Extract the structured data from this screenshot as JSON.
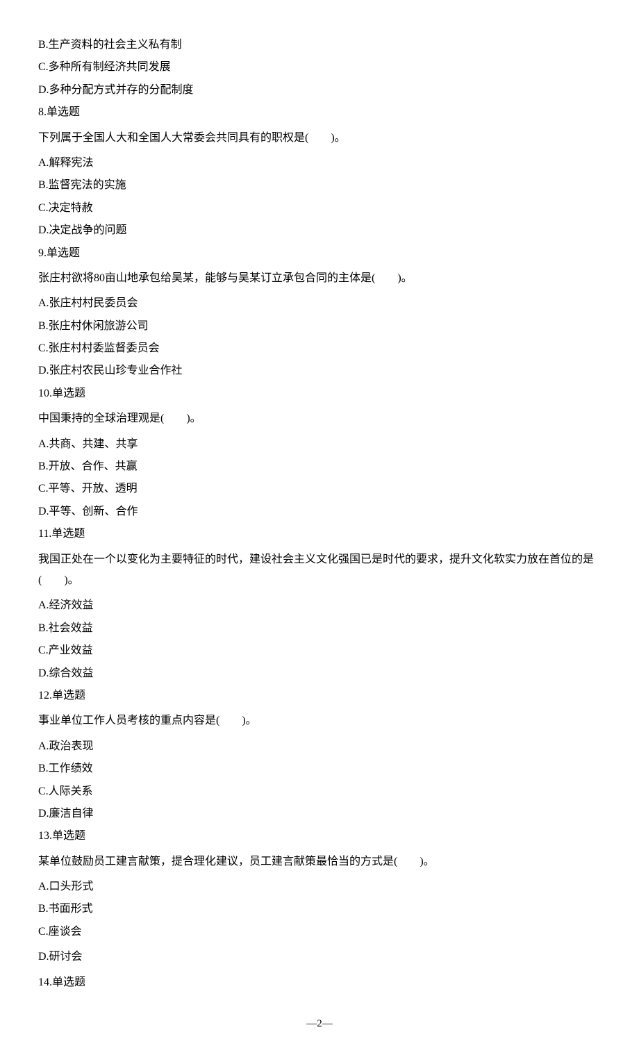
{
  "lines": {
    "l1": "B.生产资料的社会主义私有制",
    "l2": "C.多种所有制经济共同发展",
    "l3": "D.多种分配方式并存的分配制度",
    "l4": "8.单选题",
    "l5": "下列属于全国人大和全国人大常委会共同具有的职权是(　　)。",
    "l6": "A.解释宪法",
    "l7": "B.监督宪法的实施",
    "l8": "C.决定特赦",
    "l9": "D.决定战争的问题",
    "l10": "9.单选题",
    "l11": "张庄村欲将80亩山地承包给吴某，能够与吴某订立承包合同的主体是(　　)。",
    "l12": "A.张庄村村民委员会",
    "l13": "B.张庄村休闲旅游公司",
    "l14": "C.张庄村村委监督委员会",
    "l15": "D.张庄村农民山珍专业合作社",
    "l16": "10.单选题",
    "l17": "中国秉持的全球治理观是(　　)。",
    "l18": "A.共商、共建、共享",
    "l19": "B.开放、合作、共赢",
    "l20": "C.平等、开放、透明",
    "l21": "D.平等、创新、合作",
    "l22": "11.单选题",
    "l23": "我国正处在一个以变化为主要特征的时代，建设社会主义文化强国已是时代的要求，提升文化软实力放在首位的是 (　　)。",
    "l24": "A.经济效益",
    "l25": "B.社会效益",
    "l26": "C.产业效益",
    "l27": "D.综合效益",
    "l28": "12.单选题",
    "l29": "事业单位工作人员考核的重点内容是(　　)。",
    "l30": "A.政治表现",
    "l31": "B.工作绩效",
    "l32": "C.人际关系",
    "l33": "D.廉洁自律",
    "l34": "13.单选题",
    "l35": "某单位鼓励员工建言献策，提合理化建议，员工建言献策最恰当的方式是(　　)。",
    "l36": "A.口头形式",
    "l37": "B.书面形式",
    "l38": "C.座谈会",
    "l39": "D.研讨会",
    "l40": "14.单选题"
  },
  "page_number": "—2—"
}
